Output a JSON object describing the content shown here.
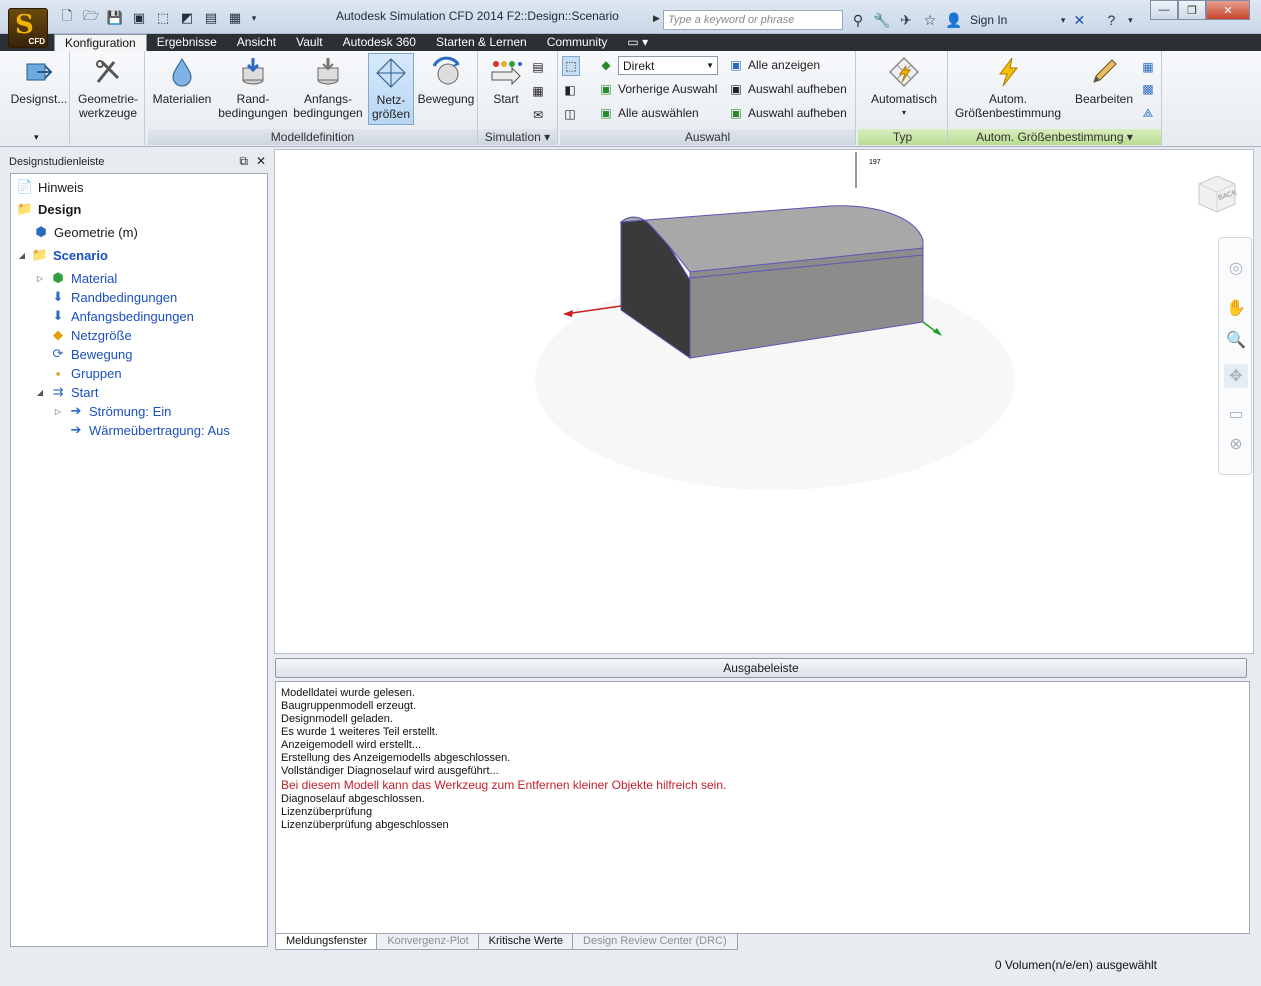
{
  "app": {
    "logo_letter": "S",
    "logo_sub": "CFD",
    "window_title": "Autodesk Simulation CFD 2014   F2::Design::Scenario",
    "search_placeholder": "Type a keyword or phrase",
    "sign_in": "Sign In"
  },
  "tabs": [
    "Konfiguration",
    "Ergebnisse",
    "Ansicht",
    "Vault",
    "Autodesk 360",
    "Starten & Lernen",
    "Community"
  ],
  "ribbon": {
    "design": {
      "label": "Designst..."
    },
    "geometry": {
      "label_line1": "Geometrie-",
      "label_line2": "werkzeuge"
    },
    "model_definition": {
      "title": "Modelldefinition",
      "buttons": [
        {
          "line1": "Materialien",
          "line2": ""
        },
        {
          "line1": "Rand-",
          "line2": "bedingungen"
        },
        {
          "line1": "Anfangs-",
          "line2": "bedingungen"
        },
        {
          "line1": "Netz-",
          "line2": "größen"
        },
        {
          "line1": "Bewegung",
          "line2": ""
        }
      ]
    },
    "simulation": {
      "title": "Simulation",
      "start": "Start"
    },
    "selection": {
      "title": "Auswahl",
      "mode": "Direkt",
      "prev": "Vorherige Auswahl",
      "select_all": "Alle auswählen",
      "show_all": "Alle anzeigen",
      "deselect1": "Auswahl aufheben",
      "deselect2": "Auswahl aufheben"
    },
    "type": {
      "title": "Typ",
      "auto": "Automatisch"
    },
    "auto_size": {
      "title": "Autom. Größenbestimmung",
      "line1": "Autom.",
      "line2": "Größenbestimmung",
      "edit": "Bearbeiten"
    }
  },
  "left_panel": {
    "title": "Designstudienleiste",
    "tree": [
      {
        "label": "Hinweis"
      },
      {
        "label": "Design"
      },
      {
        "label": "Geometrie (m)"
      },
      {
        "label": "Scenario"
      },
      {
        "label": "Material"
      },
      {
        "label": "Randbedingungen"
      },
      {
        "label": "Anfangsbedingungen"
      },
      {
        "label": "Netzgröße"
      },
      {
        "label": "Bewegung"
      },
      {
        "label": "Gruppen"
      },
      {
        "label": "Start"
      },
      {
        "label": "Strömung: Ein"
      },
      {
        "label": "Wärmeübertragung: Aus"
      }
    ]
  },
  "viewport": {
    "axis_label": "197",
    "viewcube_label": "BACK",
    "colors": {
      "solid_side": "#3a3a3a",
      "solid_front": "#8c8c8c",
      "solid_top": "#a8a8a8",
      "edge": "#5a55b8"
    }
  },
  "output": {
    "title": "Ausgabeleiste",
    "lines": [
      "Modelldatei wurde gelesen.",
      "Baugruppenmodell erzeugt.",
      "Designmodell geladen.",
      "Es wurde 1 weiteres Teil erstellt.",
      "Anzeigemodell wird erstellt...",
      "Erstellung des Anzeigemodells abgeschlossen.",
      "Vollständiger Diagnoselauf wird ausgeführt...",
      "Bei diesem Modell kann das Werkzeug zum Entfernen kleiner Objekte hilfreich sein.",
      "Diagnoselauf abgeschlossen.",
      "Lizenzüberprüfung",
      "Lizenzüberprüfung abgeschlossen"
    ],
    "warn_index": 7,
    "tabs": [
      "Meldungsfenster",
      "Konvergenz-Plot",
      "Kritische Werte",
      "Design Review Center (DRC)"
    ]
  },
  "status": {
    "text": "0 Volumen(n/e/en) ausgewählt"
  }
}
